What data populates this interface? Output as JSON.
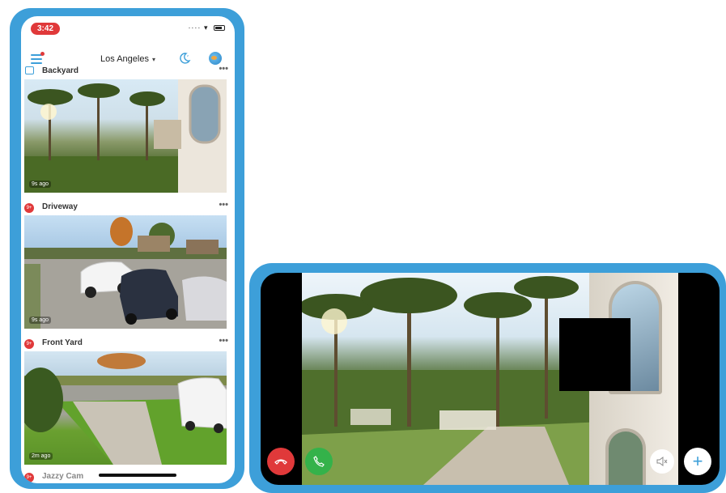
{
  "portrait": {
    "status": {
      "time": "3:42"
    },
    "header": {
      "location": "Los Angeles",
      "location_caret": "▾"
    },
    "cameras": [
      {
        "name": "Backyard",
        "ago": "9s ago",
        "more": "•••"
      },
      {
        "name": "Driveway",
        "ago": "9s ago",
        "more": "•••",
        "badge": "9+"
      },
      {
        "name": "Front Yard",
        "ago": "2m ago",
        "more": "•••",
        "badge": "9+"
      }
    ],
    "next_camera": {
      "name": "Jazzy Cam",
      "badge": "9+"
    }
  },
  "landscape": {
    "buttons": {
      "decline_icon": "decline-call-icon",
      "answer_icon": "answer-call-icon",
      "mute_icon": "speaker-muted-icon",
      "add_label": "+"
    }
  },
  "colors": {
    "frame_blue": "#3d9fd9",
    "decline_red": "#e0393a",
    "answer_green": "#34b24a"
  }
}
